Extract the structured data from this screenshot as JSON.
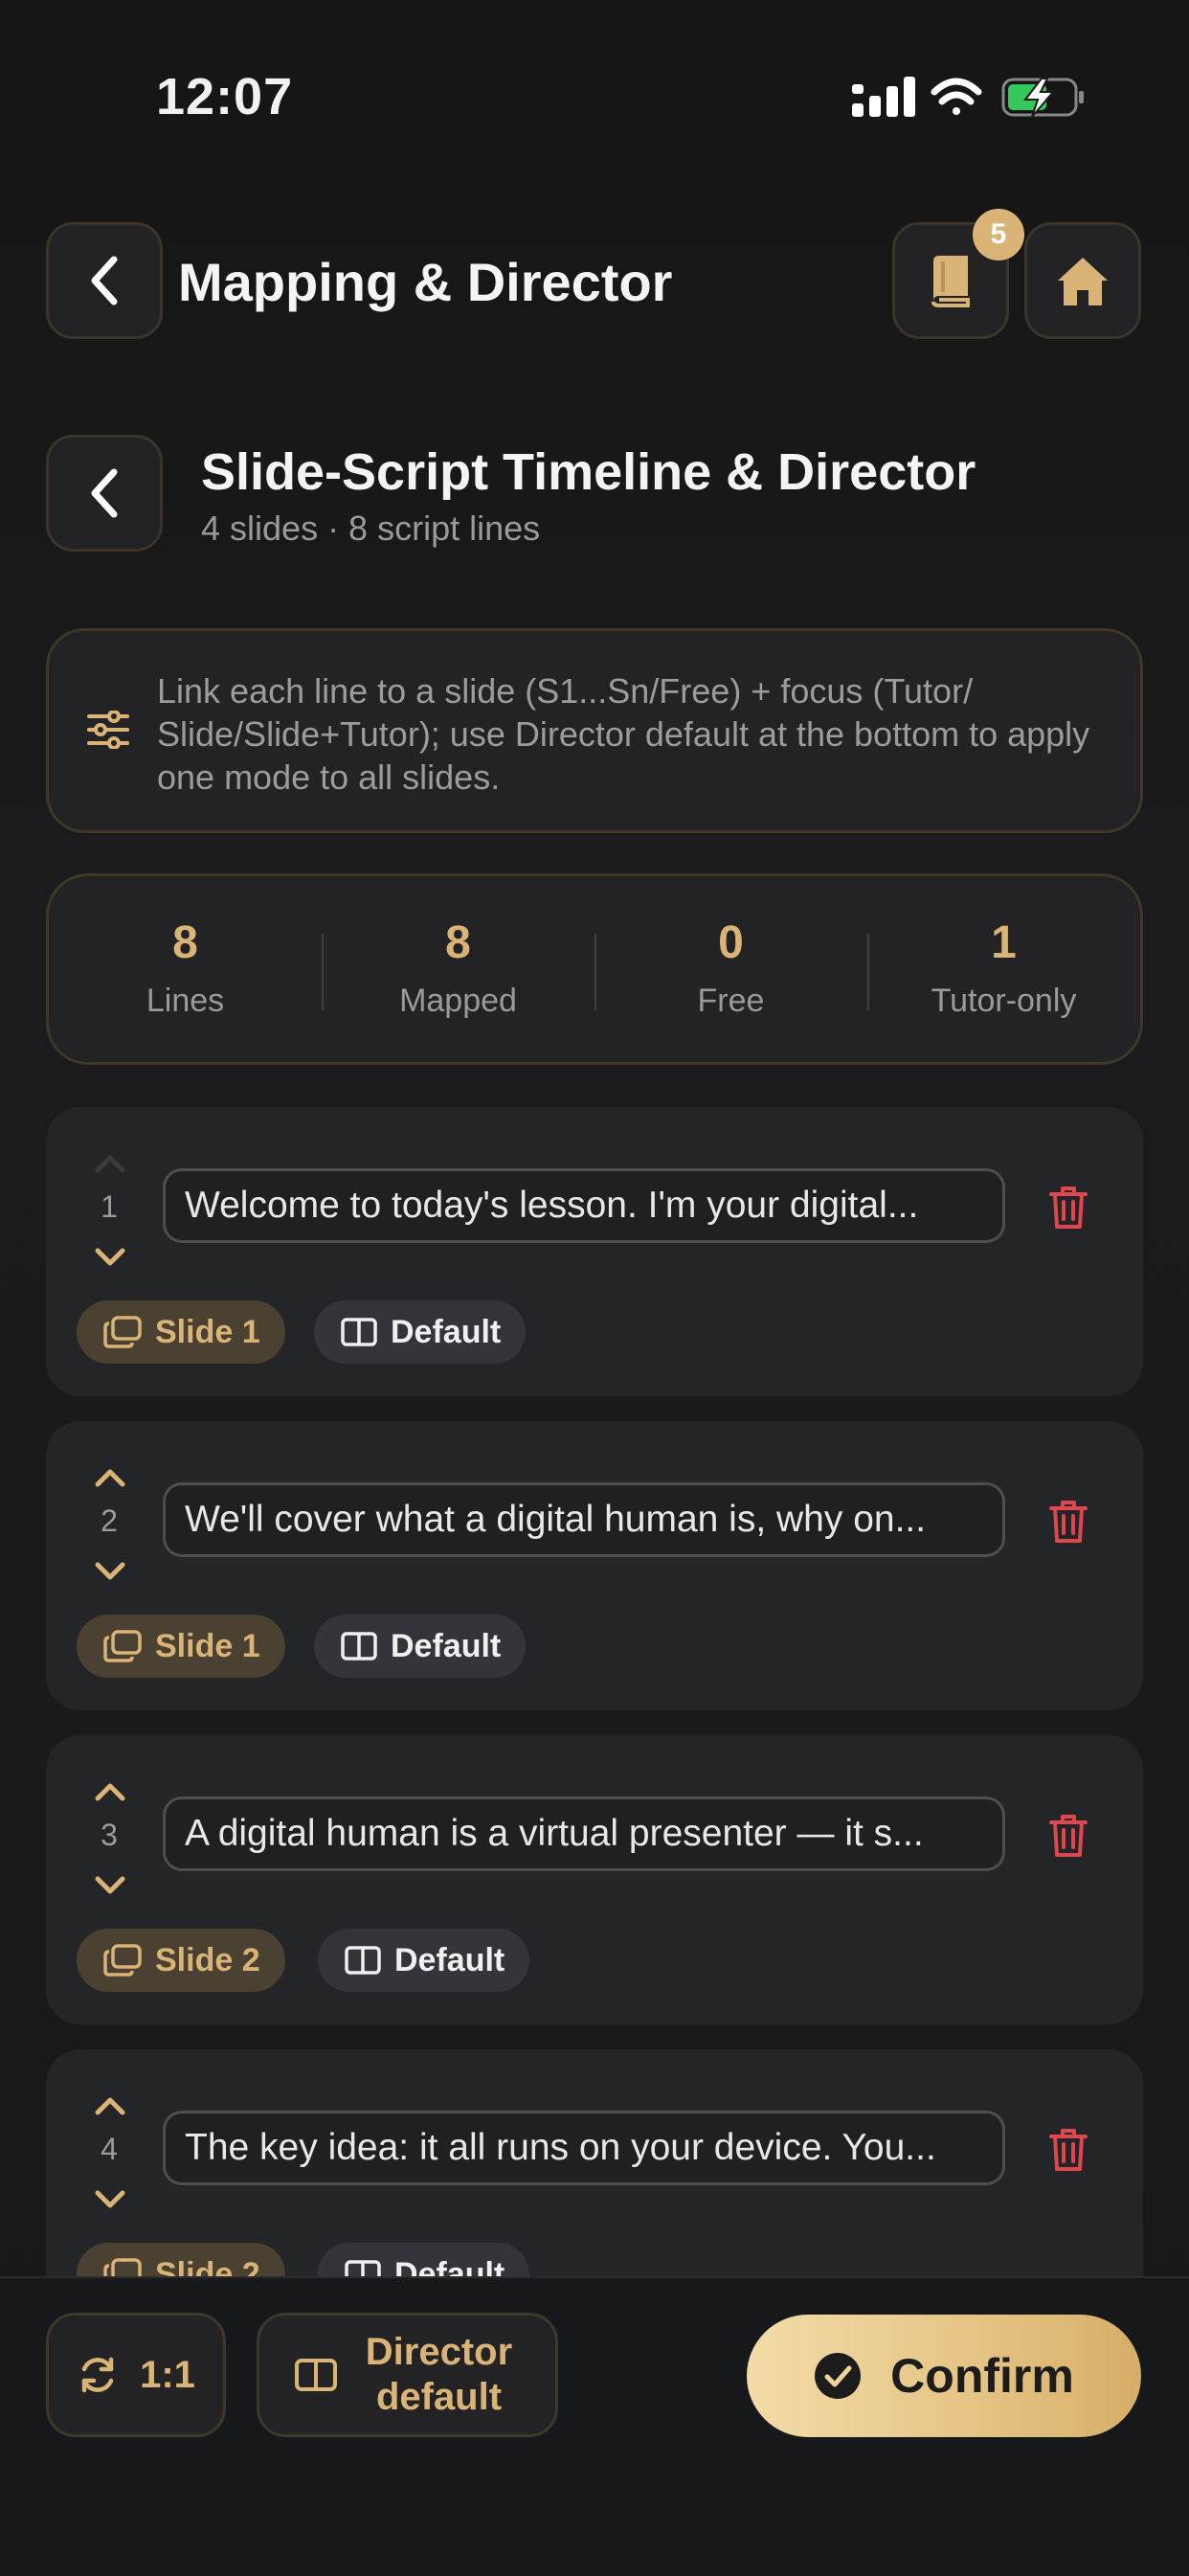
{
  "status_bar": {
    "time": "12:07"
  },
  "header": {
    "title": "Mapping & Director",
    "notification_count": "5"
  },
  "section": {
    "title": "Slide-Script Timeline & Director",
    "subtitle": "4 slides · 8 script lines"
  },
  "info": {
    "text": "Link each line to a slide (S1...Sn/Free) + focus (Tutor/ Slide/Slide+Tutor); use Director default at the bottom to apply one mode to all slides."
  },
  "stats": [
    {
      "value": "8",
      "label": "Lines"
    },
    {
      "value": "8",
      "label": "Mapped"
    },
    {
      "value": "0",
      "label": "Free"
    },
    {
      "value": "1",
      "label": "Tutor-only"
    }
  ],
  "lines": [
    {
      "number": "1",
      "text": "Welcome to today's lesson. I'm your digital...",
      "slide": "Slide 1",
      "focus": "Default"
    },
    {
      "number": "2",
      "text": "We'll cover what a digital human is, why on...",
      "slide": "Slide 1",
      "focus": "Default"
    },
    {
      "number": "3",
      "text": "A digital human is a virtual presenter — it s...",
      "slide": "Slide 2",
      "focus": "Default"
    },
    {
      "number": "4",
      "text": "The key idea: it all runs on your device. You...",
      "slide": "Slide 2",
      "focus": "Default"
    }
  ],
  "bottom_bar": {
    "ratio_label": "1:1",
    "director_label": "Director default",
    "confirm_label": "Confirm"
  },
  "colors": {
    "accent": "#d9b476",
    "danger": "#e0474c",
    "background": "#18181b"
  }
}
